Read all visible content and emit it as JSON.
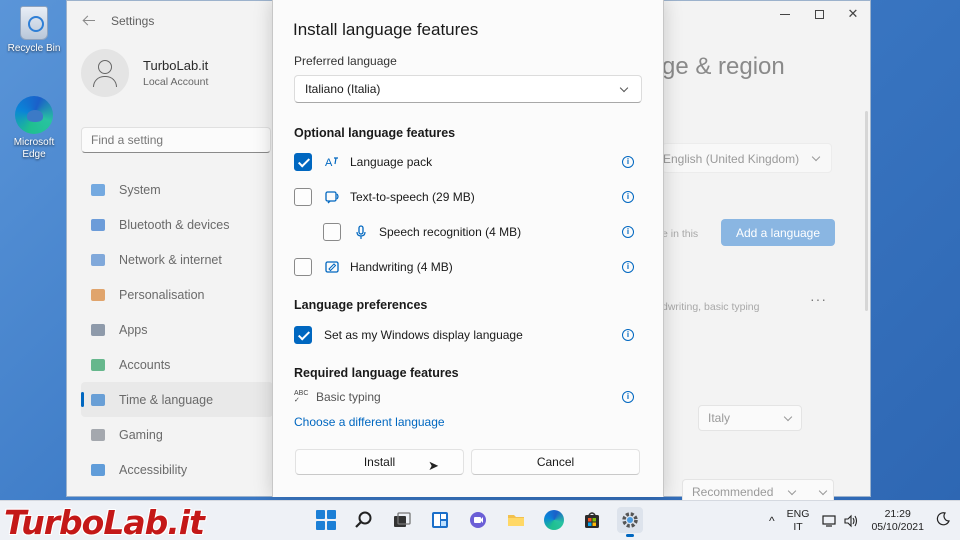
{
  "desktop": {
    "recycle_bin": "Recycle Bin",
    "edge_line1": "Microsoft",
    "edge_line2": "Edge"
  },
  "settings": {
    "title": "Settings",
    "profile": {
      "name": "TurboLab.it",
      "account_type": "Local Account"
    },
    "search_placeholder": "Find a setting",
    "nav": [
      {
        "label": "System",
        "icon": "monitor-icon",
        "color": "#4a90d9"
      },
      {
        "label": "Bluetooth & devices",
        "icon": "bluetooth-icon",
        "color": "#3f7fd0"
      },
      {
        "label": "Network & internet",
        "icon": "wifi-icon",
        "color": "#5a8fd2"
      },
      {
        "label": "Personalisation",
        "icon": "brush-icon",
        "color": "#d9893f"
      },
      {
        "label": "Apps",
        "icon": "apps-icon",
        "color": "#6c7c91"
      },
      {
        "label": "Accounts",
        "icon": "person-icon",
        "color": "#37a36a"
      },
      {
        "label": "Time & language",
        "icon": "globe-icon",
        "color": "#3e86cf"
      },
      {
        "label": "Gaming",
        "icon": "gamepad-icon",
        "color": "#8a8f97"
      },
      {
        "label": "Accessibility",
        "icon": "accessibility-icon",
        "color": "#2f7fd0"
      }
    ],
    "right_pane": {
      "title": "ge & region",
      "display_language_value": "English (United Kingdom)",
      "in_this_fragment": "e in this",
      "add_language_button": "Add a language",
      "language_features_fragment": "dwriting, basic typing",
      "more_dots": "···",
      "region_value": "Italy",
      "regional_format_value": "Recommended"
    }
  },
  "dialog": {
    "title": "Install language features",
    "preferred_language_label": "Preferred language",
    "preferred_language_value": "Italiano (Italia)",
    "optional_section": "Optional language features",
    "optional_features": [
      {
        "label": "Language pack",
        "checked": true,
        "icon": "language-pack-icon"
      },
      {
        "label": "Text-to-speech (29 MB)",
        "checked": false,
        "icon": "text-to-speech-icon"
      },
      {
        "label": "Speech recognition (4 MB)",
        "checked": false,
        "icon": "microphone-icon"
      },
      {
        "label": "Handwriting (4 MB)",
        "checked": false,
        "icon": "handwriting-icon"
      }
    ],
    "preferences_section": "Language preferences",
    "display_language_option": "Set as my Windows display language",
    "display_language_checked": true,
    "required_section": "Required language features",
    "required_feature": "Basic typing",
    "required_feature_icon_text": "ABC",
    "different_language_link": "Choose a different language",
    "install_button": "Install",
    "cancel_button": "Cancel",
    "info_glyph": "i"
  },
  "taskbar": {
    "brand": "TurboLab.it",
    "language_line1": "ENG",
    "language_line2": "IT",
    "time": "21:29",
    "date": "05/10/2021",
    "tray_chevron": "^"
  },
  "colors": {
    "accent": "#0067c0",
    "wallpaper": "#3c7ac6"
  }
}
